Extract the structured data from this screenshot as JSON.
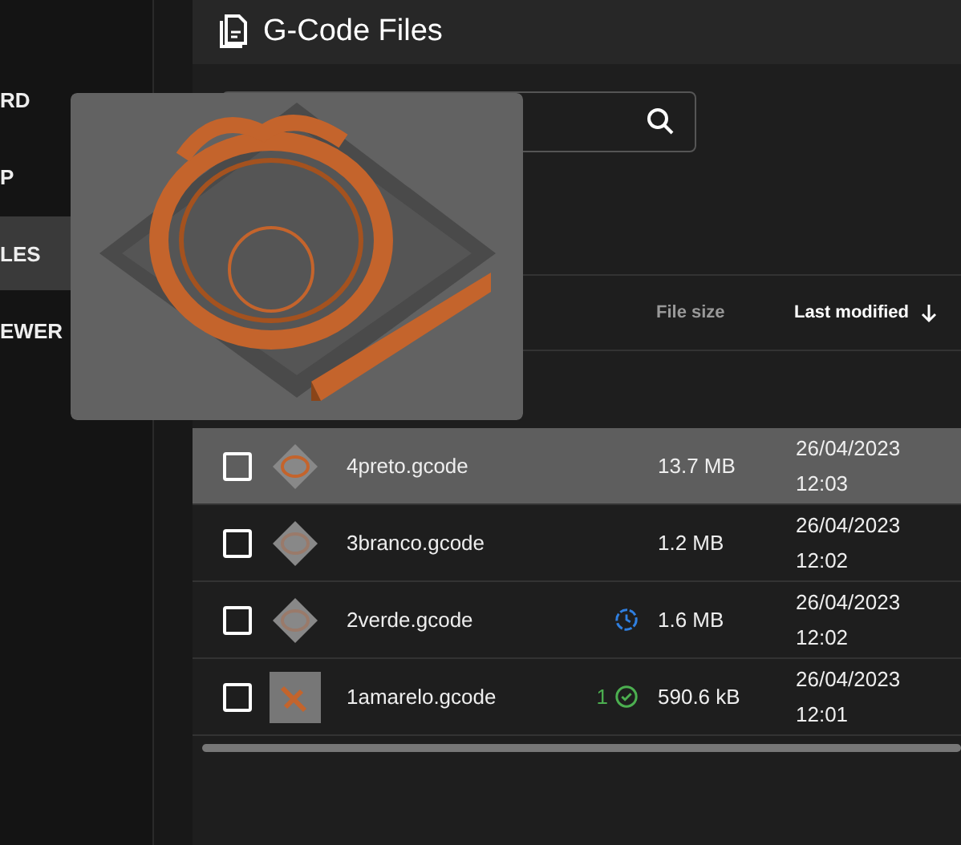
{
  "sidebar": {
    "items": [
      {
        "label": "RD",
        "selected": false
      },
      {
        "label": "P",
        "selected": false
      },
      {
        "label": "LES",
        "selected": true
      },
      {
        "label": "EWER",
        "selected": false
      }
    ]
  },
  "header": {
    "title": "G-Code Files"
  },
  "table": {
    "columns": [
      {
        "label": "File size",
        "sorted": false
      },
      {
        "label": "Last modified",
        "sorted": true
      }
    ],
    "rows": [
      {
        "name": "4preto.gcode",
        "size": "13.7 MB",
        "date": "26/04/2023",
        "time": "12:03",
        "selected": true,
        "checked": false
      },
      {
        "name": "3branco.gcode",
        "size": "1.2 MB",
        "date": "26/04/2023",
        "time": "12:02",
        "selected": false,
        "checked": false
      },
      {
        "name": "2verde.gcode",
        "size": "1.6 MB",
        "date": "26/04/2023",
        "time": "12:02",
        "selected": false,
        "checked": false,
        "status": {
          "kind": "queued"
        }
      },
      {
        "name": "1amarelo.gcode",
        "size": "590.6 kB",
        "date": "26/04/2023",
        "time": "12:01",
        "selected": false,
        "checked": false,
        "status": {
          "kind": "printed",
          "count": "1"
        }
      }
    ]
  }
}
